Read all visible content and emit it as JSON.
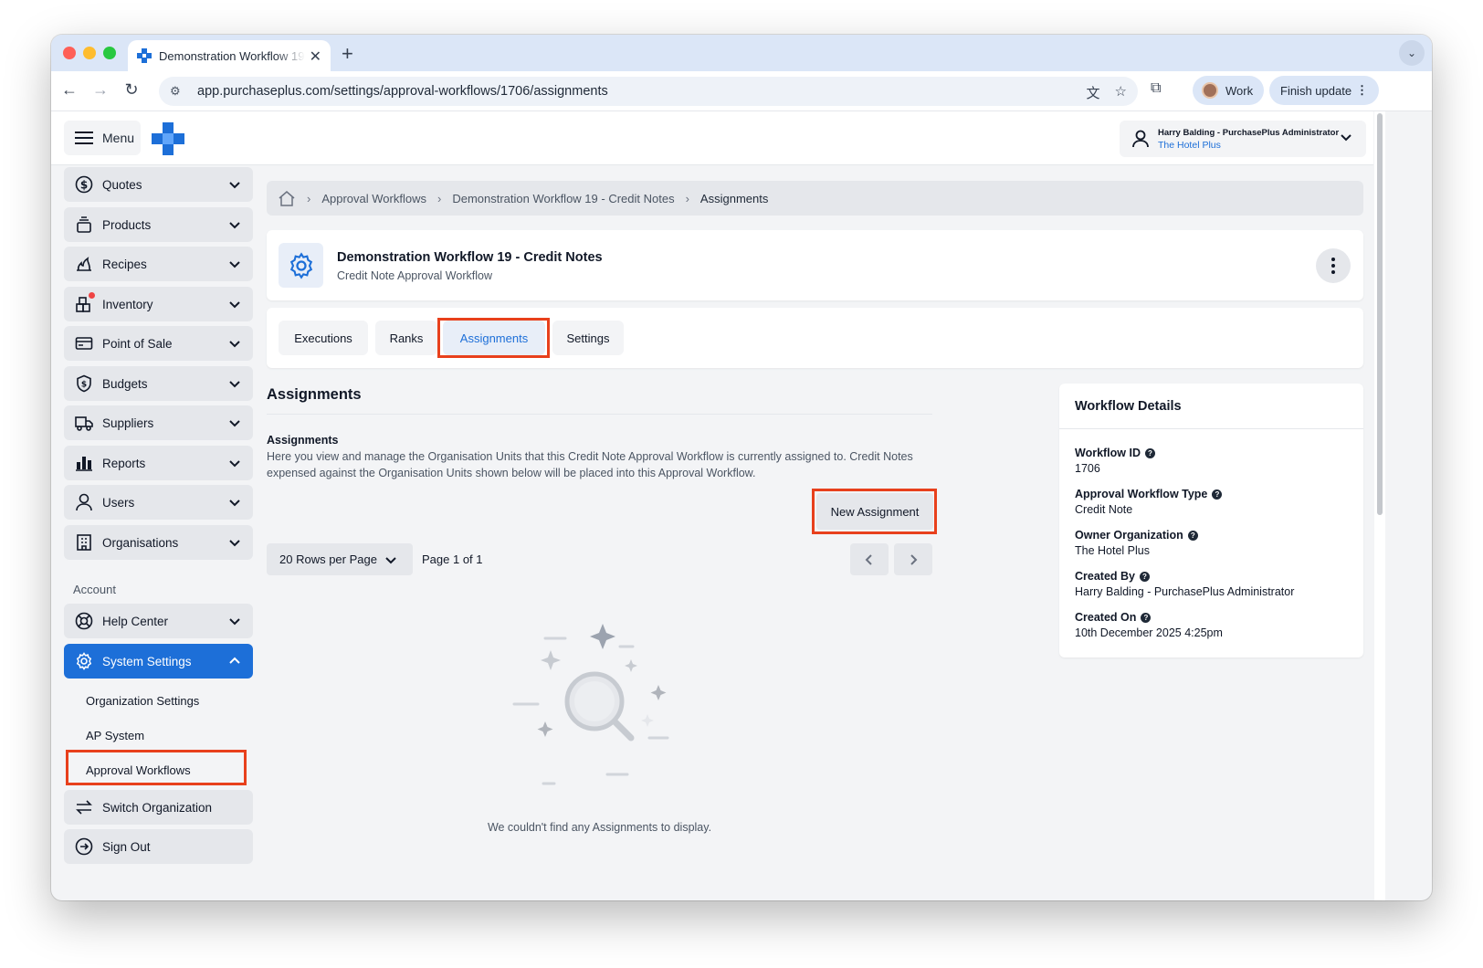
{
  "browser": {
    "tab_title": "Demonstration Workflow 19 - Credit Notes",
    "url": "app.purchaseplus.com/settings/approval-workflows/1706/assignments",
    "profile_label": "Work",
    "update_label": "Finish update"
  },
  "header": {
    "menu_label": "Menu",
    "user_name": "Harry Balding - PurchasePlus Administrator",
    "user_org": "The Hotel Plus"
  },
  "sidebar": {
    "items": [
      {
        "label": "Quotes",
        "icon": "dollar-circle-icon"
      },
      {
        "label": "Products",
        "icon": "box-stack-icon"
      },
      {
        "label": "Recipes",
        "icon": "flame-icon"
      },
      {
        "label": "Inventory",
        "icon": "inventory-boxes-icon"
      },
      {
        "label": "Point of Sale",
        "icon": "credit-card-icon"
      },
      {
        "label": "Budgets",
        "icon": "shield-dollar-icon"
      },
      {
        "label": "Suppliers",
        "icon": "truck-icon"
      },
      {
        "label": "Reports",
        "icon": "bar-chart-icon"
      },
      {
        "label": "Users",
        "icon": "user-icon"
      },
      {
        "label": "Organisations",
        "icon": "building-icon"
      }
    ],
    "account_heading": "Account",
    "help_center": "Help Center",
    "system_settings": "System Settings",
    "sub_items": [
      "Organization Settings",
      "AP System",
      "Approval Workflows"
    ],
    "switch_org": "Switch Organization",
    "sign_out": "Sign Out"
  },
  "breadcrumb": {
    "items": [
      "Approval Workflows",
      "Demonstration Workflow 19 - Credit Notes",
      "Assignments"
    ]
  },
  "workflow": {
    "title": "Demonstration Workflow 19 - Credit Notes",
    "subtitle": "Credit Note Approval Workflow"
  },
  "tabs": [
    "Executions",
    "Ranks",
    "Assignments",
    "Settings"
  ],
  "active_tab": "Assignments",
  "assignments": {
    "section_title": "Assignments",
    "sub_title": "Assignments",
    "description": "Here you view and manage the Organisation Units that this Credit Note Approval Workflow is currently assigned to. Credit Notes expensed against the Organisation Units shown below will be placed into this Approval Workflow.",
    "new_button": "New Assignment",
    "rows_per_page": "20 Rows per Page",
    "page_info": "Page 1 of 1",
    "empty_message": "We couldn't find any Assignments to display."
  },
  "details": {
    "heading": "Workflow Details",
    "fields": [
      {
        "label": "Workflow ID",
        "value": "1706"
      },
      {
        "label": "Approval Workflow Type",
        "value": "Credit Note"
      },
      {
        "label": "Owner Organization",
        "value": "The Hotel Plus"
      },
      {
        "label": "Created By",
        "value": "Harry Balding - PurchasePlus Administrator"
      },
      {
        "label": "Created On",
        "value": "10th December 2025 4:25pm"
      }
    ]
  },
  "colors": {
    "brand_blue": "#1d6fd8",
    "highlight_red": "#e8401c"
  }
}
